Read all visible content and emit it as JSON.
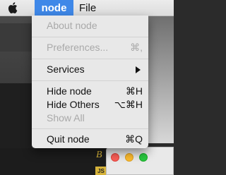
{
  "menubar": {
    "apple_icon": "apple-icon",
    "app_menu": "node",
    "file_menu": "File"
  },
  "app_menu_items": {
    "about": "About node",
    "preferences": "Preferences...",
    "preferences_shortcut": "⌘,",
    "services": "Services",
    "hide": "Hide node",
    "hide_shortcut": "⌘H",
    "hide_others": "Hide Others",
    "hide_others_shortcut": "⌥⌘H",
    "show_all": "Show All",
    "quit": "Quit node",
    "quit_shortcut": "⌘Q"
  },
  "background": {
    "code_letter": "B",
    "file_badge": "JS"
  },
  "colors": {
    "menu_highlight": "#3f88e8",
    "disabled_text": "#a9a9a9"
  }
}
